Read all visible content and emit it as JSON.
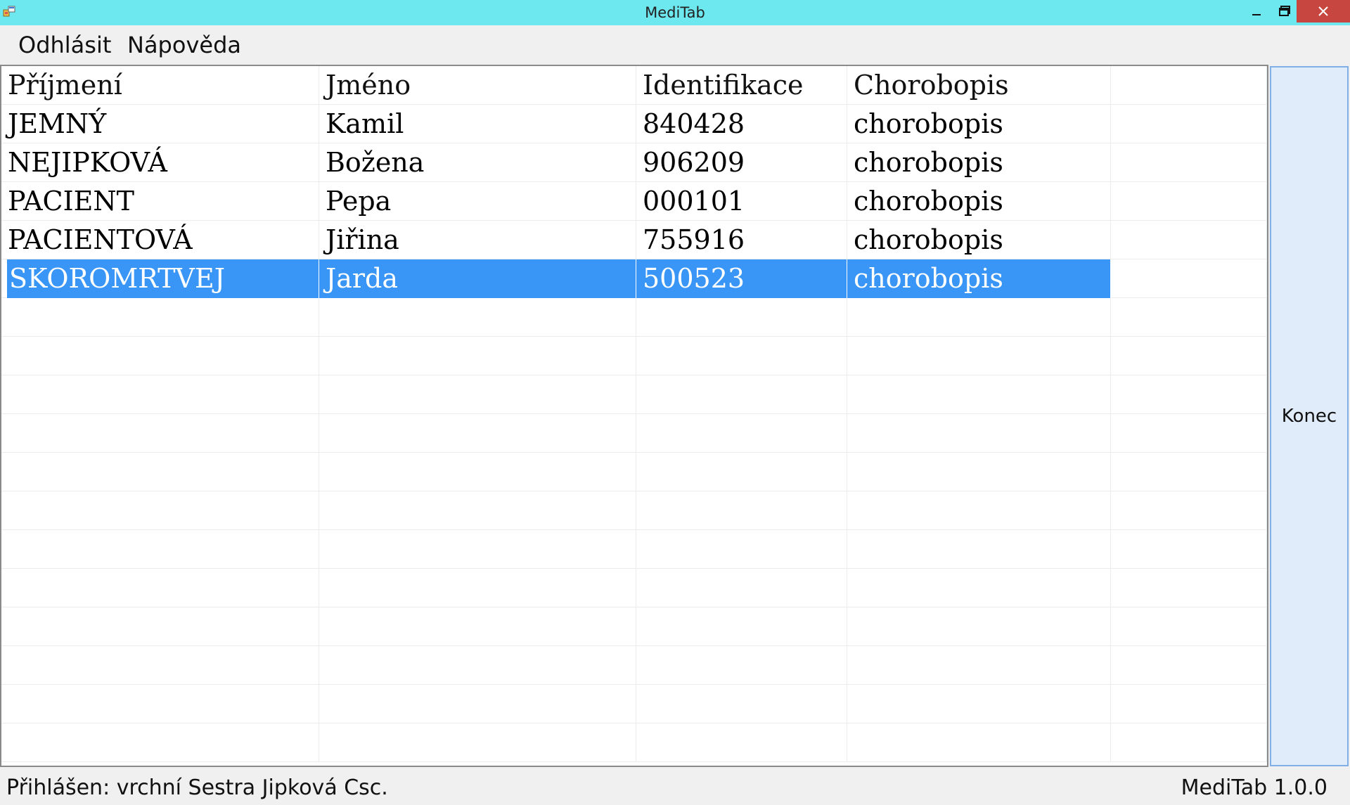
{
  "window": {
    "title": "MediTab",
    "controls": {
      "minimize_icon": "minimize-icon",
      "maximize_icon": "restore-icon",
      "close_icon": "close-icon"
    }
  },
  "menu": {
    "logout": "Odhlásit",
    "help": "Nápověda"
  },
  "table": {
    "columns": [
      "Příjmení",
      "Jméno",
      "Identifikace",
      "Chorobopis"
    ],
    "rows": [
      [
        "JEMNÝ",
        "Kamil",
        "840428",
        "chorobopis"
      ],
      [
        "NEJIPKOVÁ",
        "Božena",
        "906209",
        "chorobopis"
      ],
      [
        "PACIENT",
        "Pepa",
        "000101",
        "chorobopis"
      ],
      [
        "PACIENTOVÁ",
        "Jiřina",
        "755916",
        "chorobopis"
      ],
      [
        "SKOROMRTVEJ",
        "Jarda",
        "500523",
        "chorobopis"
      ]
    ],
    "selected_row_index": 4,
    "selection_color": "#3a96f6"
  },
  "buttons": {
    "konec": "Konec"
  },
  "status": {
    "user": "Přihlášen: vrchní Sestra Jipková Csc.",
    "version": "MediTab 1.0.0"
  },
  "colors": {
    "titlebar": "#6ee8ef",
    "close_button": "#c7463f",
    "konec_button": "#e1ecfb"
  }
}
